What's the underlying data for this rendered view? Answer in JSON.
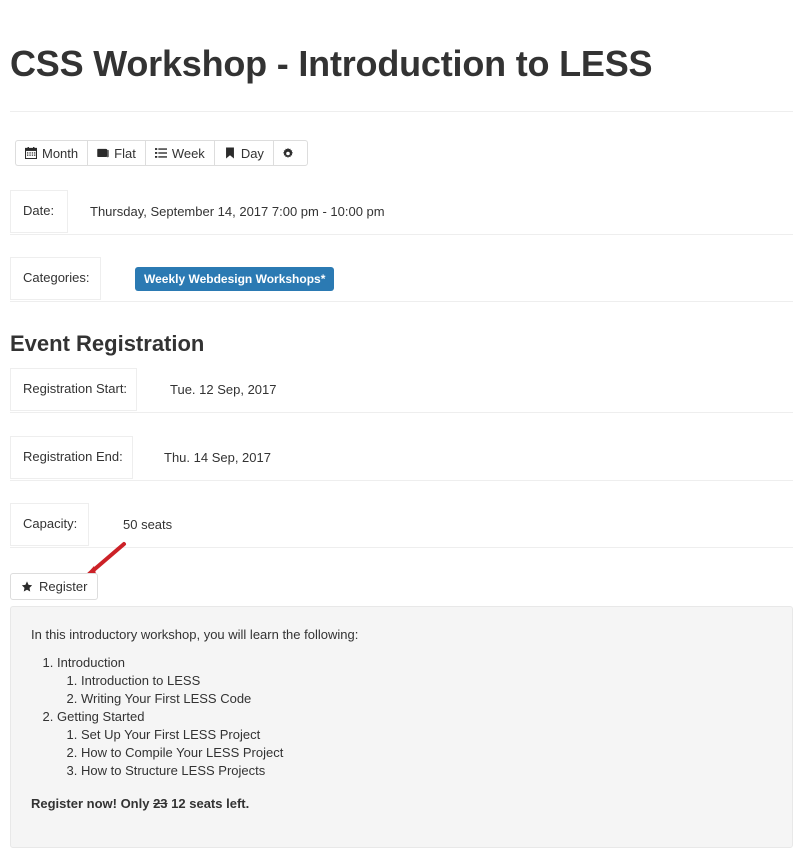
{
  "page": {
    "title": "CSS Workshop - Introduction to LESS",
    "section_heading": "Event Registration"
  },
  "toolbar": {
    "buttons": [
      {
        "label": "Month",
        "icon": "calendar-icon"
      },
      {
        "label": "Flat",
        "icon": "book-icon"
      },
      {
        "label": "Week",
        "icon": "list-icon"
      },
      {
        "label": "Day",
        "icon": "bookmark-icon"
      },
      {
        "label": "",
        "icon": "gear-icon"
      }
    ]
  },
  "details": {
    "date": {
      "label": "Date:",
      "value": "Thursday, September 14, 2017 7:00 pm - 10:00 pm"
    },
    "categories": {
      "label": "Categories:",
      "badge": "Weekly Webdesign Workshops*"
    },
    "registration_start": {
      "label": "Registration Start:",
      "value": "Tue. 12 Sep, 2017"
    },
    "registration_end": {
      "label": "Registration End:",
      "value": "Thu. 14 Sep, 2017"
    },
    "capacity": {
      "label": "Capacity:",
      "value": "50 seats"
    }
  },
  "register": {
    "label": "Register",
    "icon": "star-icon"
  },
  "annotation": {
    "arrow_color": "#cc2127"
  },
  "description": {
    "intro": "In this introductory workshop, you will learn the following:",
    "outline": [
      {
        "label": "Introduction",
        "children": [
          "Introduction to LESS",
          "Writing Your First LESS Code"
        ]
      },
      {
        "label": "Getting Started",
        "children": [
          "Set Up Your First LESS Project",
          "How to Compile Your LESS Project",
          "How to Structure LESS Projects"
        ]
      }
    ],
    "outro": {
      "prefix": "Register now! Only ",
      "struck": "23",
      "middle": " 12",
      "suffix": " seats left."
    }
  },
  "colors": {
    "badge_blue": "#2b7ab3",
    "panel_bg": "#f5f5f5",
    "border": "#eeeeee",
    "text": "#333333"
  }
}
